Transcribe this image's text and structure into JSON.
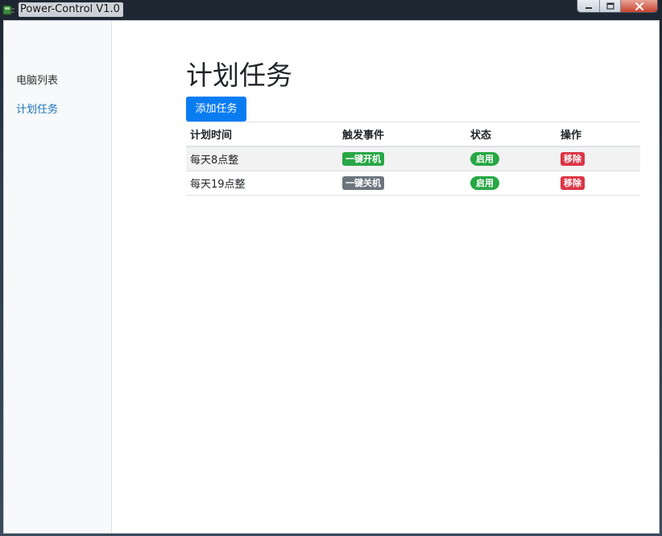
{
  "window": {
    "title": "Power-Control V1.0"
  },
  "sidebar": {
    "items": [
      {
        "label": "电脑列表",
        "active": false
      },
      {
        "label": "计划任务",
        "active": true
      }
    ]
  },
  "main": {
    "title": "计划任务",
    "add_button": "添加任务",
    "table": {
      "headers": [
        "计划时间",
        "触发事件",
        "状态",
        "操作"
      ],
      "rows": [
        {
          "time": "每天8点整",
          "event": "一键开机",
          "event_color": "#28a745",
          "status": "启用",
          "action": "移除"
        },
        {
          "time": "每天19点整",
          "event": "一键关机",
          "event_color": "#6c757d",
          "status": "启用",
          "action": "移除"
        }
      ]
    }
  },
  "colors": {
    "accent": "#0a7cf2",
    "active_nav": "#1a73b8",
    "success": "#28a745",
    "secondary": "#6c757d",
    "danger": "#dc3545"
  },
  "icons": {
    "app": "power-plug-icon",
    "minimize": "minimize-icon",
    "maximize": "maximize-icon",
    "close": "close-icon"
  }
}
